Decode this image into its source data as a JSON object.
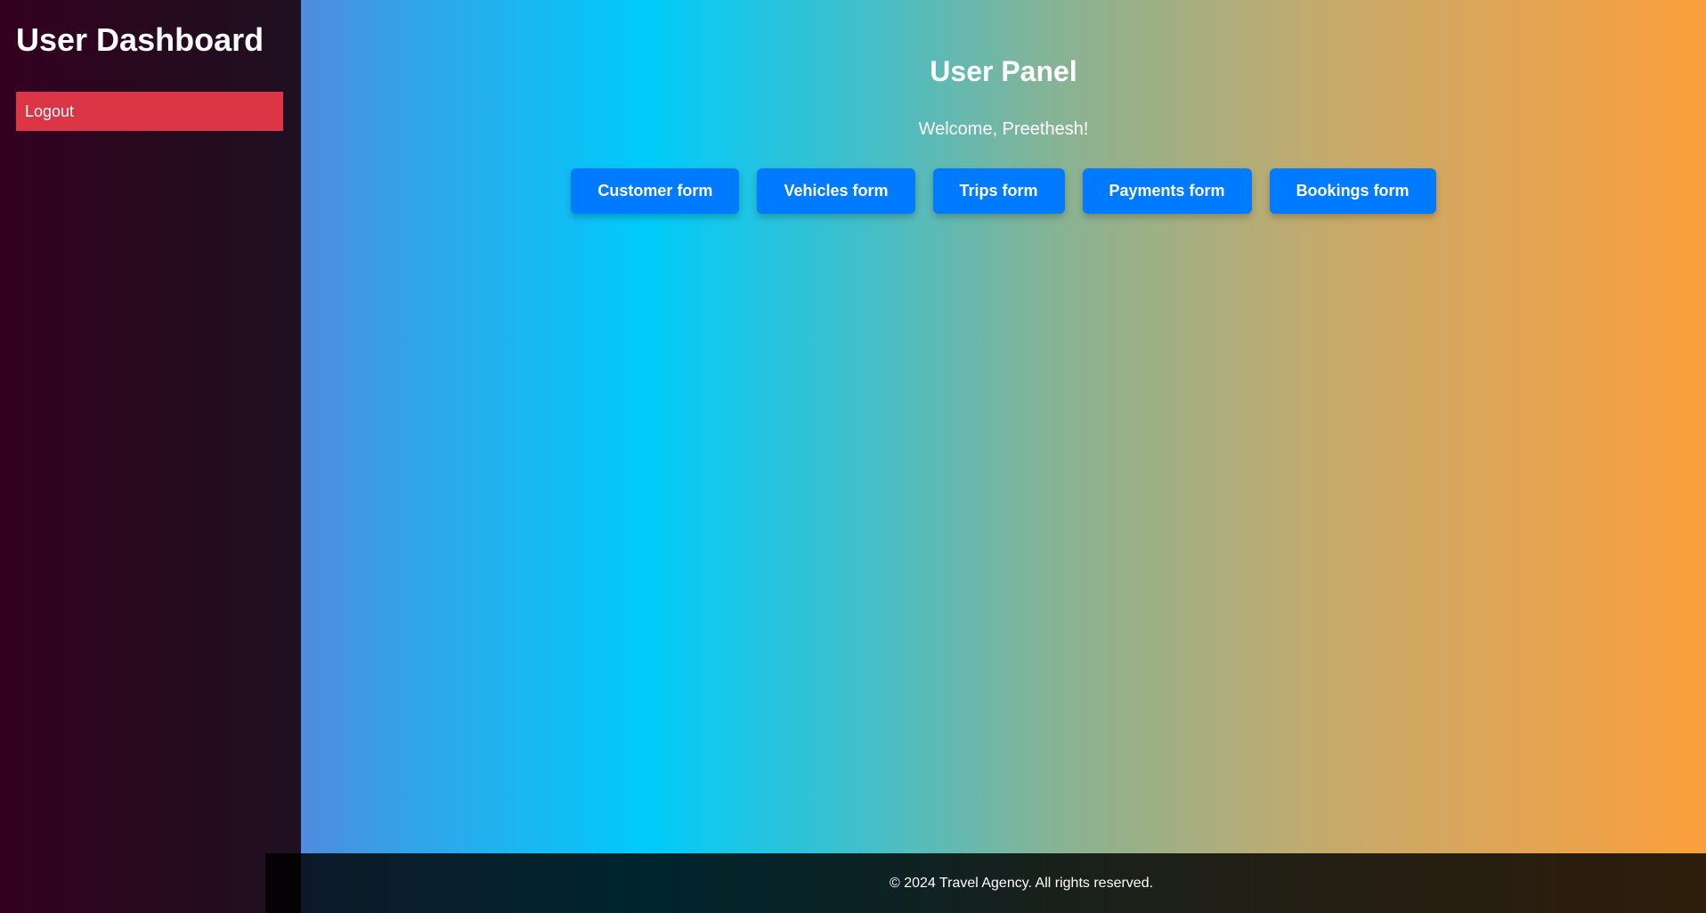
{
  "sidebar": {
    "title": "User Dashboard",
    "logout_label": "Logout"
  },
  "main": {
    "title": "User Panel",
    "welcome": "Welcome, Preethesh!",
    "buttons": [
      {
        "label": "Customer form"
      },
      {
        "label": "Vehicles form"
      },
      {
        "label": "Trips form"
      },
      {
        "label": "Payments form"
      },
      {
        "label": "Bookings form"
      }
    ]
  },
  "footer": {
    "text": "© 2024 Travel Agency. All rights reserved."
  },
  "colors": {
    "button_blue": "#007bff",
    "logout_red": "#dc3545",
    "sidebar_dark": "#27091f"
  }
}
